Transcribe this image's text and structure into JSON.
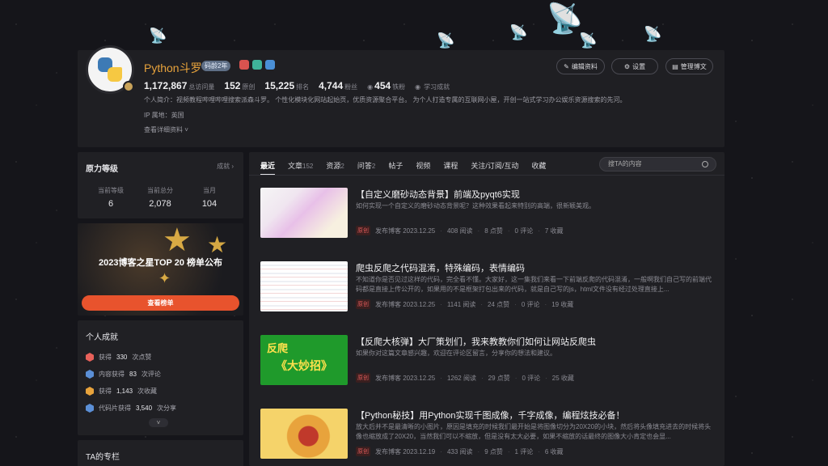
{
  "profile": {
    "username": "Python斗罗",
    "code_age": "码龄2年",
    "stats": [
      {
        "value": "1,172,867",
        "label": "总访问量"
      },
      {
        "value": "152",
        "label": "原创"
      },
      {
        "value": "15,225",
        "label": "排名"
      },
      {
        "value": "4,744",
        "label": "粉丝"
      },
      {
        "value": "454",
        "label": "铁粉"
      },
      {
        "value": "",
        "label": "学习成就"
      }
    ],
    "intro": "个人简介：视频教程哔哩哔哩搜索派森斗罗。 个性化模块化网站起始页，优质资源聚合平台。 为个人打造专属的互联网小屋，开创一站式学习办公娱乐资源搜索的先河。",
    "ip": "IP 属地：英国",
    "more": "查看详细资料",
    "buttons": {
      "edit": "编辑资料",
      "settings": "设置",
      "manage": "管理博文"
    }
  },
  "influence": {
    "title": "原力等级",
    "link": "成就",
    "items": [
      {
        "label": "当前等级",
        "value": "6"
      },
      {
        "label": "当前总分",
        "value": "2,078"
      },
      {
        "label": "当月",
        "value": "104"
      }
    ]
  },
  "promo": {
    "title": "2023博客之星TOP 20 榜单公布",
    "button": "查看榜单"
  },
  "achievements": {
    "title": "个人成就",
    "items": [
      {
        "pre": "获得 ",
        "num": "330",
        "post": " 次点赞",
        "color": "#e8615a"
      },
      {
        "pre": "内容获得 ",
        "num": "83",
        "post": " 次评论",
        "color": "#5b8fd6"
      },
      {
        "pre": "获得 ",
        "num": "1,143",
        "post": " 次收藏",
        "color": "#e8a33c"
      },
      {
        "pre": "代码片获得 ",
        "num": "3,540",
        "post": " 次分享",
        "color": "#5b8fd6"
      }
    ]
  },
  "column": {
    "title": "TA的专栏"
  },
  "tabs": [
    {
      "label": "最近",
      "count": ""
    },
    {
      "label": "文章",
      "count": "152"
    },
    {
      "label": "资源",
      "count": "2"
    },
    {
      "label": "问答",
      "count": "2"
    },
    {
      "label": "帖子",
      "count": ""
    },
    {
      "label": "视频",
      "count": ""
    },
    {
      "label": "课程",
      "count": ""
    },
    {
      "label": "关注/订阅/互动",
      "count": ""
    },
    {
      "label": "收藏",
      "count": ""
    }
  ],
  "search": {
    "placeholder": "搜TA的内容"
  },
  "articles": [
    {
      "title": "【自定义磨砂动态背景】前端及pyqt6实现",
      "desc": "如何实现一个自定义的磨砂动态背景呢？这种效果看起来特别的高端，很新颖美观。",
      "tag": "原创",
      "date": "发布博客 2023.12.25",
      "views": "408 阅读",
      "likes": "8 点赞",
      "comments": "0 评论",
      "favs": "7 收藏"
    },
    {
      "title": "爬虫反爬之代码混淆，特殊编码，表情编码",
      "desc": "不知道你是否见过这样的代码，完全看不懂。大家好，这一集我们来看一下前端反爬的代码混淆，一般啊我们自己写的前端代码都是直接上传公开的，如果用的不是框架打包出来的代码，就是自己写的js，html文件没有经过处理直接上...",
      "tag": "原创",
      "date": "发布博客 2023.12.25",
      "views": "1141 阅读",
      "likes": "24 点赞",
      "comments": "0 评论",
      "favs": "19 收藏"
    },
    {
      "title": "【反爬大核弹】大厂策划们，我来教教你们如何让网站反爬虫",
      "desc": "如果你对这篇文章感兴趣，欢迎在评论区留言，分享你的想法和建议。",
      "tag": "原创",
      "date": "发布博客 2023.12.25",
      "views": "1262 阅读",
      "likes": "29 点赞",
      "comments": "0 评论",
      "favs": "25 收藏",
      "thumb_text1": "反爬",
      "thumb_text2": "《大妙招》"
    },
    {
      "title": "【Python秘技】用Python实现千图成像，千字成像，编程炫技必备！",
      "desc": "放大后并不是最清晰的小图片，原因是填充的时候我们最开始是将图像切分为20X20的小块，然后将头像填充进去的时候将头像也缩放成了20X20，当然我们可以不缩放，但是没有太大必要，如果不缩放的话最终的图像大小肯定也会显...",
      "tag": "原创",
      "date": "发布博客 2023.12.19",
      "views": "433 阅读",
      "likes": "9 点赞",
      "comments": "1 评论",
      "favs": "6 收藏"
    }
  ],
  "colors": {
    "accent": "#e8a33c",
    "primary_button": "#e8532d",
    "tag": "#e05a5a"
  }
}
